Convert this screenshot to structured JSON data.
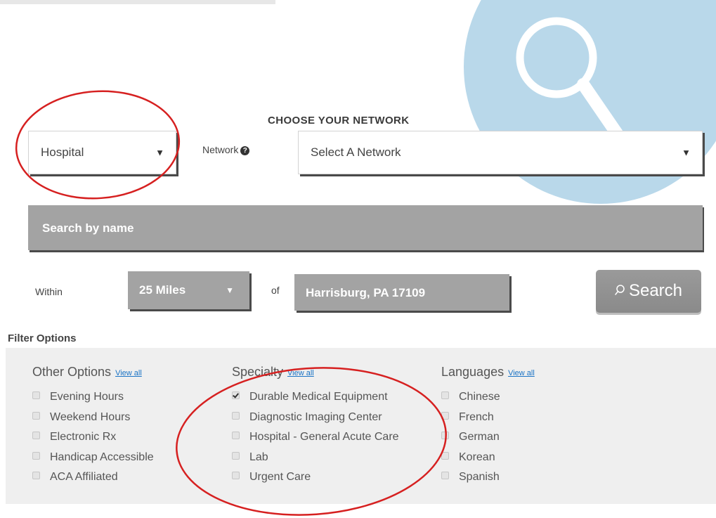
{
  "network_section": {
    "title": "CHOOSE YOUR NETWORK",
    "provider_type_select": {
      "value": "Hospital"
    },
    "network_label": "Network",
    "network_select": {
      "value": "Select A Network"
    }
  },
  "search": {
    "name_placeholder": "Search by name",
    "within_label": "Within",
    "distance_select": {
      "value": "25 Miles"
    },
    "of_label": "of",
    "location_value": "Harrisburg, PA 17109",
    "button_label": "Search"
  },
  "filters": {
    "title": "Filter Options",
    "view_all_label": "View all",
    "other_options": {
      "heading": "Other Options",
      "items": [
        {
          "label": "Evening Hours",
          "checked": false
        },
        {
          "label": "Weekend Hours",
          "checked": false
        },
        {
          "label": "Electronic Rx",
          "checked": false
        },
        {
          "label": "Handicap Accessible",
          "checked": false
        },
        {
          "label": "ACA Affiliated",
          "checked": false
        }
      ]
    },
    "specialty": {
      "heading": "Specialty",
      "items": [
        {
          "label": "Durable Medical Equipment",
          "checked": true
        },
        {
          "label": "Diagnostic Imaging Center",
          "checked": false
        },
        {
          "label": "Hospital - General Acute Care",
          "checked": false
        },
        {
          "label": "Lab",
          "checked": false
        },
        {
          "label": "Urgent Care",
          "checked": false
        }
      ]
    },
    "languages": {
      "heading": "Languages",
      "items": [
        {
          "label": "Chinese",
          "checked": false
        },
        {
          "label": "French",
          "checked": false
        },
        {
          "label": "German",
          "checked": false
        },
        {
          "label": "Korean",
          "checked": false
        },
        {
          "label": "Spanish",
          "checked": false
        }
      ]
    }
  },
  "colors": {
    "accent_circle": "#b9d8ea",
    "field_gray": "#a3a3a3",
    "annotation_red": "#d62020",
    "link_blue": "#1a73c5"
  },
  "icons": {
    "background": "magnifier-icon",
    "help": "question-circle-icon",
    "caret": "caret-down-icon",
    "search": "magnifier-icon"
  }
}
